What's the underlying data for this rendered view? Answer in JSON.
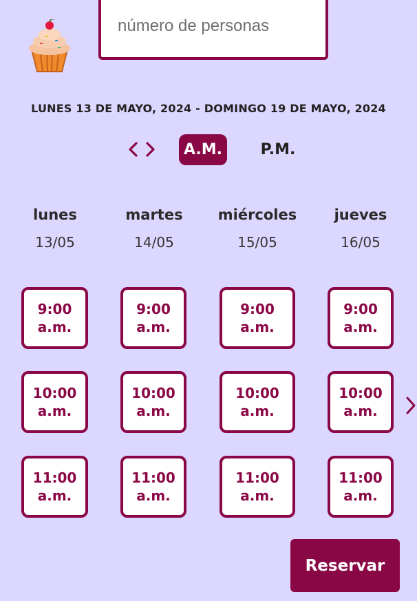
{
  "people_input": {
    "placeholder": "número de personas",
    "value": ""
  },
  "date_range": "LUNES 13 DE MAYO, 2024 - DOMINGO 19 DE MAYO, 2024",
  "period": {
    "am_label": "A.M.",
    "pm_label": "P.M.",
    "selected": "A.M."
  },
  "days": [
    {
      "name": "lunes",
      "date": "13/05"
    },
    {
      "name": "martes",
      "date": "14/05"
    },
    {
      "name": "miércoles",
      "date": "15/05"
    },
    {
      "name": "jueves",
      "date": "16/05"
    }
  ],
  "slots": [
    {
      "time": "9:00",
      "suffix": "a.m."
    },
    {
      "time": "10:00",
      "suffix": "a.m."
    },
    {
      "time": "11:00",
      "suffix": "a.m."
    }
  ],
  "reserve_label": "Reservar",
  "icons": {
    "logo": "cupcake-icon",
    "nav": "code-brackets-icon",
    "next": "chevron-right-icon"
  },
  "colors": {
    "accent": "#8a0746",
    "background": "#dcd7ff"
  }
}
